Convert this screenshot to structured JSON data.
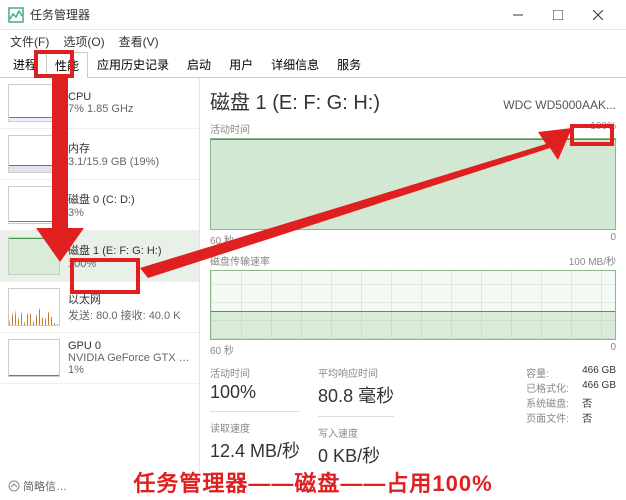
{
  "window": {
    "title": "任务管理器"
  },
  "menu": {
    "file": "文件(F)",
    "options": "选项(O)",
    "view": "查看(V)"
  },
  "tabs": [
    "进程",
    "性能",
    "应用历史记录",
    "启动",
    "用户",
    "详细信息",
    "服务"
  ],
  "active_tab": 1,
  "sidebar": {
    "items": [
      {
        "name": "CPU",
        "sub": "7% 1.85 GHz"
      },
      {
        "name": "内存",
        "sub": "3.1/15.9 GB (19%)"
      },
      {
        "name": "磁盘 0 (C: D:)",
        "sub": "3%"
      },
      {
        "name": "磁盘 1 (E: F: G: H:)",
        "sub": "100%"
      },
      {
        "name": "以太网",
        "sub": "发送: 80.0 接收: 40.0 K"
      },
      {
        "name": "GPU 0",
        "sub": "NVIDIA GeForce GTX …",
        "extra": "1%"
      }
    ]
  },
  "main": {
    "title": "磁盘 1 (E: F: G: H:)",
    "model": "WDC WD5000AAK...",
    "chart1": {
      "label": "活动时间",
      "right": "100%",
      "x_left": "60 秒",
      "x_right": "0"
    },
    "chart2": {
      "label": "磁盘传输速率",
      "right": "100 MB/秒",
      "x_left": "60 秒",
      "x_right": "0"
    },
    "stats": {
      "active_label": "活动时间",
      "active": "100%",
      "resp_label": "平均响应时间",
      "resp": "80.8 毫秒",
      "read_label": "读取速度",
      "read": "12.4 MB/秒",
      "write_label": "写入速度",
      "write": "0 KB/秒",
      "cap_k": "容量:",
      "cap_v": "466 GB",
      "fmt_k": "已格式化:",
      "fmt_v": "466 GB",
      "sys_k": "系统磁盘:",
      "sys_v": "否",
      "page_k": "页面文件:",
      "page_v": "否"
    }
  },
  "footer": {
    "less": "简略信…"
  },
  "annotation": {
    "caption": "任务管理器——磁盘——占用100%"
  },
  "chart_data": {
    "type": "line",
    "title": "磁盘 1 活动时间",
    "x": "60 秒 → 0",
    "ylim": [
      0,
      100
    ],
    "series": [
      {
        "name": "活动时间 %",
        "values": [
          100,
          100,
          100,
          100,
          100,
          100,
          100,
          100,
          100,
          100
        ]
      },
      {
        "name": "传输速率 MB/秒",
        "values": [
          40,
          42,
          38,
          45,
          40,
          41,
          39,
          40,
          42,
          40
        ],
        "ylim": [
          0,
          100
        ]
      }
    ]
  }
}
